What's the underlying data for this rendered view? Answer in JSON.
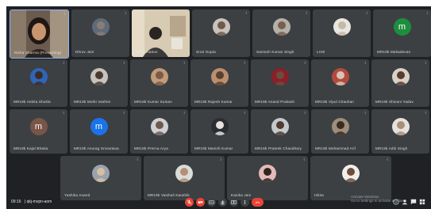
{
  "row1": [
    {
      "name": "Nisha Sharma (Presenting)",
      "kind": "video",
      "type": "woman"
    },
    {
      "name": "Dhruv Jain",
      "kind": "photo",
      "bg": "#5f6b7a",
      "skin": "#8a7d74"
    },
    {
      "name": "Presentation",
      "kind": "video",
      "type": "room"
    },
    {
      "name": "Sruti Gupta",
      "kind": "photo",
      "bg": "#c9c2bc",
      "skin": "#6f5a4e"
    },
    {
      "name": "Santosh Kumar Singh",
      "kind": "photo",
      "bg": "#b5b0a8",
      "skin": "#7a5f50"
    },
    {
      "name": "LIVE",
      "kind": "photo",
      "bg": "#e8e6e0",
      "skin": "#c7b8a8"
    },
    {
      "name": "MR19b Mahadevan",
      "kind": "letter",
      "letter": "m",
      "bg": "#1e8e3e"
    }
  ],
  "row2": [
    {
      "name": "MR19b Ankita Shukla",
      "kind": "photo",
      "bg": "#2f64b8",
      "skin": "#3e2b22"
    },
    {
      "name": "MR19b Mohit Vashist",
      "kind": "photo",
      "bg": "#c7c2bb",
      "skin": "#4a3a32"
    },
    {
      "name": "MR19b Kumar Suman",
      "kind": "photo",
      "bg": "#c29b7a",
      "skin": "#7b5a46"
    },
    {
      "name": "MR19b Rajesh Kumar",
      "kind": "photo",
      "bg": "#ba8f70",
      "skin": "#5a3f30"
    },
    {
      "name": "MR19b Anand Prakash",
      "kind": "photo",
      "bg": "#8a1f2a",
      "skin": "#6b4d3d"
    },
    {
      "name": "MR19b Vipul Chauhan",
      "kind": "photo",
      "bg": "#b34a3f",
      "skin": "#d8c4b4"
    },
    {
      "name": "MR19b Shivani Yadav",
      "kind": "photo",
      "bg": "#d7d1c8",
      "skin": "#5a3a2e"
    }
  ],
  "row3": [
    {
      "name": "MR19b Kajal Bhatia",
      "kind": "letter",
      "letter": "m",
      "bg": "#795548"
    },
    {
      "name": "MR19b Anurag Srivastava",
      "kind": "letter",
      "letter": "m",
      "bg": "#1a73e8"
    },
    {
      "name": "MR19b Prerna Arya",
      "kind": "photo",
      "bg": "#cfd0d4",
      "skin": "#6d5a4c"
    },
    {
      "name": "MR19b Manish Kumar",
      "kind": "photo",
      "bg": "#2a2d31",
      "skin": "#e6e2dd"
    },
    {
      "name": "MR19b Prateek Chaudhary",
      "kind": "photo",
      "bg": "#c4c9cc",
      "skin": "#4f3b30"
    },
    {
      "name": "MR19b Mohammad Arif",
      "kind": "photo",
      "bg": "#9d8e7a",
      "skin": "#3b2a22"
    },
    {
      "name": "MR19b Aditi Singh",
      "kind": "photo",
      "bg": "#e5e1dc",
      "skin": "#a88f7a"
    }
  ],
  "row4": [
    {
      "name": "Yashika Anand",
      "kind": "photo",
      "bg": "#9aa3ad",
      "skin": "#d6bfa6"
    },
    {
      "name": "MR19b Vaishali Kaushik",
      "kind": "photo",
      "bg": "#d9ddd9",
      "skin": "#b58e74"
    },
    {
      "name": "Kanika Jain",
      "kind": "photo",
      "bg": "#e6b9b9",
      "skin": "#2f2520"
    },
    {
      "name": "Ishita",
      "kind": "photo",
      "bg": "#f1eeea",
      "skin": "#6f4d3d"
    }
  ],
  "footer": {
    "time": "09:16",
    "meeting_code": "| qkj-mvpn-aom",
    "activate_1": "Activate Windows",
    "activate_2": "Go to Settings to activate Windows."
  }
}
